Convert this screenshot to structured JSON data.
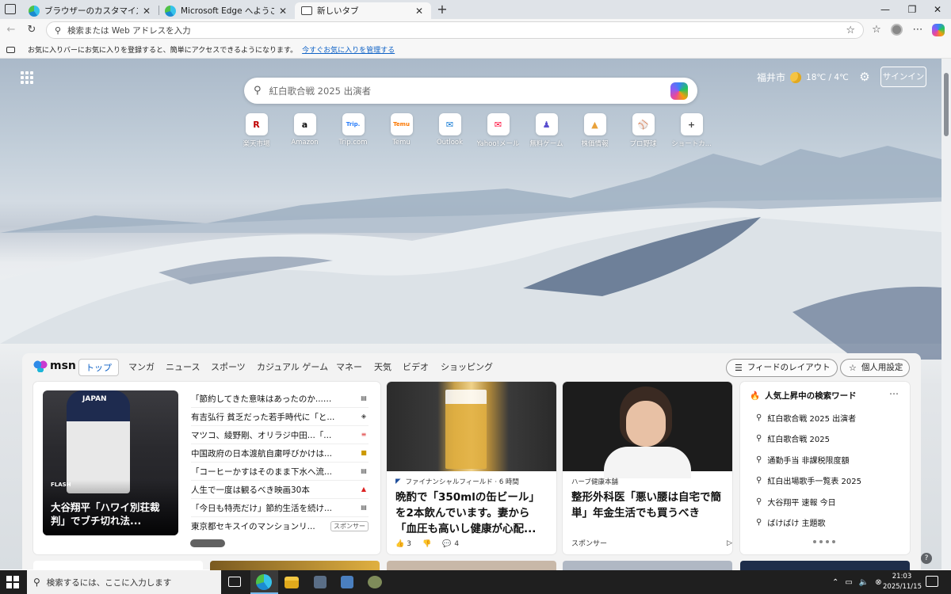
{
  "browser": {
    "tabs": [
      {
        "title": "ブラウザーのカスタマイズ",
        "close": "✕"
      },
      {
        "title": "Microsoft Edge へようこそ",
        "close": "✕"
      },
      {
        "title": "新しいタブ",
        "close": "✕"
      }
    ],
    "new_tab_symbol": "+",
    "window_buttons": [
      "—",
      "❐",
      "✕"
    ],
    "address_placeholder": "検索または Web アドレスを入力",
    "favorites_bar": {
      "message": "お気に入りバーにお気に入りを登録すると、簡単にアクセスできるようになります。",
      "link": "今すぐお気に入りを管理する"
    }
  },
  "page": {
    "weather": {
      "city": "福井市",
      "temp": "18℃ / 4℃",
      "icon": "moon-icon"
    },
    "signin": "サインイン",
    "search_placeholder": "紅白歌合戦 2025 出演者",
    "quick_links": [
      {
        "label": "楽天市場",
        "glyph": "R",
        "color": "#bf0000"
      },
      {
        "label": "Amazon",
        "glyph": "a",
        "color": "#111111"
      },
      {
        "label": "Trip.com",
        "glyph": "Trip.",
        "color": "#287dfa"
      },
      {
        "label": "Temu",
        "glyph": "Temu",
        "color": "#fb7701"
      },
      {
        "label": "Outlook",
        "glyph": "✉",
        "color": "#0f78d4"
      },
      {
        "label": "Yahoo!メール",
        "glyph": "✉",
        "color": "#ff0033"
      },
      {
        "label": "無料ゲーム",
        "glyph": "♟",
        "color": "#5a4fcf"
      },
      {
        "label": "株価情報",
        "glyph": "▲",
        "color": "#e9a23b"
      },
      {
        "label": "プロ野球",
        "glyph": "⚾",
        "color": "#1e4aa8"
      },
      {
        "label": "ショートカ...",
        "glyph": "+",
        "color": "#444444"
      }
    ]
  },
  "feed": {
    "logo": "msn",
    "tabs": [
      "トップ",
      "マンガ",
      "ニュース",
      "スポーツ",
      "カジュアル ゲーム",
      "マネー",
      "天気",
      "ビデオ",
      "ショッピング"
    ],
    "active_tab": "トップ",
    "layout_button": "フィードのレイアウト",
    "personalize_button": "個人用設定",
    "hero": {
      "brand": "FLASH",
      "headline": "大谷翔平「ハワイ別荘裁判」でブチ切れ法..."
    },
    "news": [
      {
        "title": "「節約してきた意味はあったのか...…"
      },
      {
        "title": "有吉弘行 貧乏だった若手時代に「と..."
      },
      {
        "title": "マツコ、綾野剛、オリラジ中田...「..."
      },
      {
        "title": "中国政府の日本渡航自粛呼びかけは..."
      },
      {
        "title": "「コーヒーかすはそのまま下水へ流..."
      },
      {
        "title": "人生で一度は観るべき映画30本"
      },
      {
        "title": "「今日も特売だけ」節約生活を続け..."
      },
      {
        "title": "東京都セキスイのマンションリ...",
        "sponsor": "スポンサー"
      }
    ],
    "articles": [
      {
        "source": "ファイナンシャルフィールド · 6 時間",
        "title": "晩酌で「350mlの缶ビール」を2本飲んでいます。妻から「血圧も高いし健康が心配...",
        "likes": "3",
        "comments": "4"
      },
      {
        "source": "ハーブ健康本舗",
        "title": "整形外科医「悪い腰は自宅で簡単」年金生活でも買うべき",
        "sponsor": "スポンサー"
      }
    ],
    "trending": {
      "title": "人気上昇中の検索ワード",
      "items": [
        "紅白歌合戦 2025 出演者",
        "紅白歌合戦 2025",
        "通勤手当 非課税限度額",
        "紅白出場歌手一覧表 2025",
        "大谷翔平 速報 今日",
        "ばけばけ 主題歌"
      ]
    }
  },
  "taskbar": {
    "search_placeholder": "検索するには、ここに入力します",
    "time": "21:03",
    "date": "2025/11/15"
  }
}
